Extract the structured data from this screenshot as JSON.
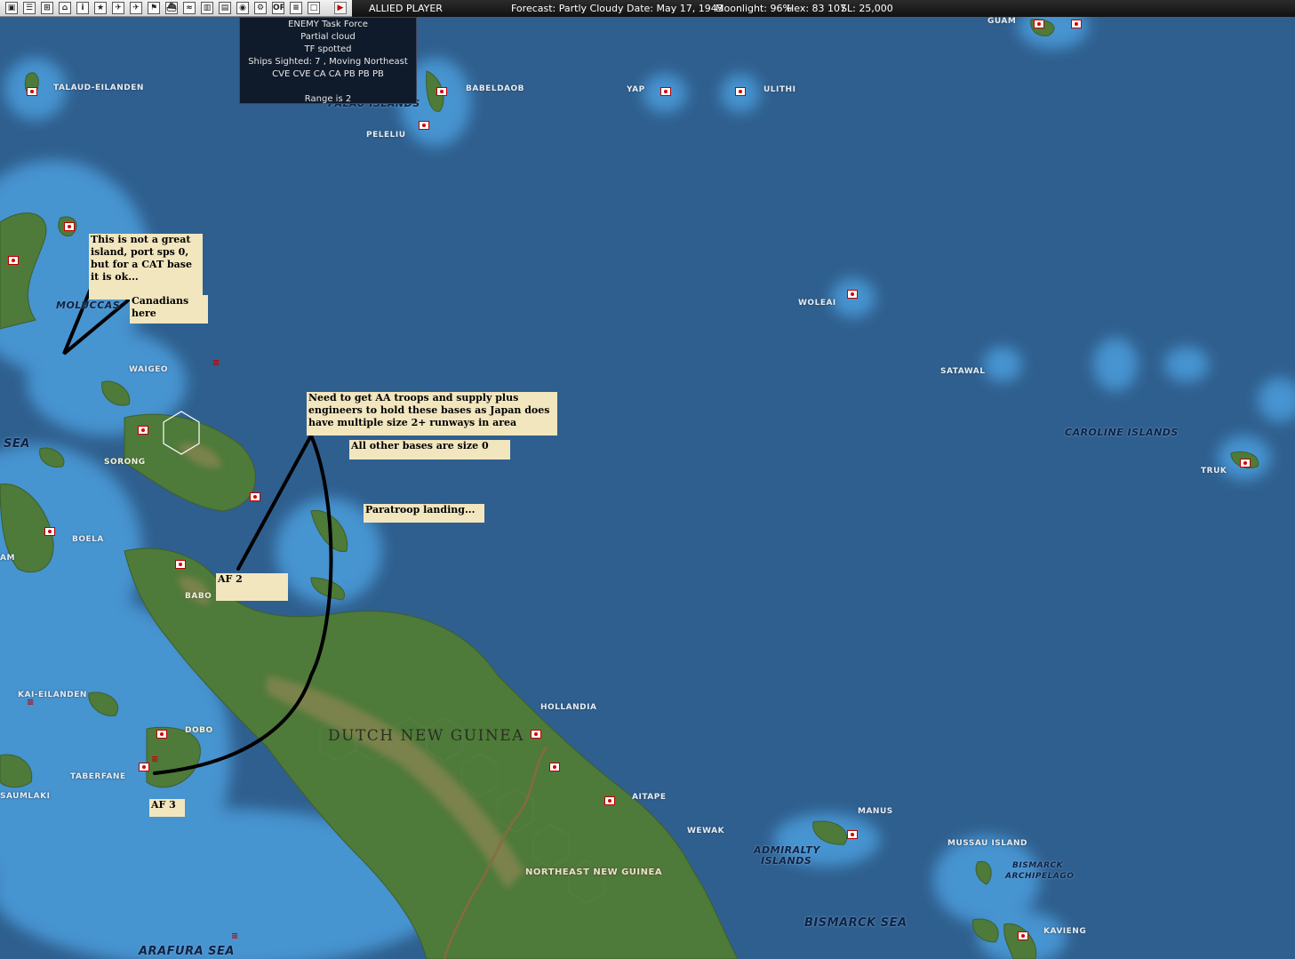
{
  "toolbar": {
    "buttons": [
      {
        "name": "save-button",
        "glyph": "▣"
      },
      {
        "name": "reports-button",
        "glyph": "☰"
      },
      {
        "name": "intel-button",
        "glyph": "⊞"
      },
      {
        "name": "info-button",
        "glyph": "⌂"
      },
      {
        "name": "database-button",
        "glyph": "i"
      },
      {
        "name": "medal-button",
        "glyph": "★"
      },
      {
        "name": "fighter-button",
        "glyph": "✈"
      },
      {
        "name": "bomber-button",
        "glyph": "✈"
      },
      {
        "name": "flag-button",
        "glyph": "⚑"
      },
      {
        "name": "ship-button",
        "glyph": "⛴"
      },
      {
        "name": "lcu-button",
        "glyph": "≈"
      },
      {
        "name": "chart-button",
        "glyph": "▥"
      },
      {
        "name": "map-button",
        "glyph": "▤"
      },
      {
        "name": "globe-button",
        "glyph": "◉"
      },
      {
        "name": "settings-button",
        "glyph": "⚙"
      },
      {
        "name": "op-button",
        "glyph": "OP"
      },
      {
        "name": "list-button",
        "glyph": "≡"
      },
      {
        "name": "window-button",
        "glyph": "□"
      },
      {
        "name": "end-turn-button",
        "glyph": "▶"
      }
    ],
    "player": "ALLIED PLAYER",
    "forecast": "Forecast: Partly Cloudy",
    "date": "Date: May 17, 1943",
    "moonlight": "Moonlight: 96%",
    "hex": "Hex: 83 107",
    "sl": "SL: 25,000"
  },
  "map_labels": {
    "guam": "GUAM",
    "talaud": "TALAUD-EILANDEN",
    "palau": "PALAU ISLANDS",
    "babeldaob": "BABELDAOB",
    "yap": "YAP",
    "ulithi": "ULITHI",
    "peleliu": "PELELIU",
    "moluccas": "MOLUCCAS",
    "waigeo": "WAIGEO",
    "woleai": "WOLEAI",
    "satawal": "SATAWAL",
    "caroline": "CAROLINE ISLANDS",
    "truk": "TRUK",
    "sea": "SEA",
    "sorong": "SORONG",
    "boela": "BOELA",
    "am": "AM",
    "babo": "BABO",
    "kai": "KAI-EILANDEN",
    "hollandia": "HOLLANDIA",
    "dutch_new_guinea": "DUTCH NEW GUINEA",
    "dobo": "DOBO",
    "taberfane": "TABERFANE",
    "saumlaki": "SAUMLAKI",
    "aitape": "AITAPE",
    "manus": "MANUS",
    "wewak": "WEWAK",
    "admiralty": "ADMIRALTY",
    "admiralty2": "ISLANDS",
    "mussau": "MUSSAU ISLAND",
    "bismarck_arch": "BISMARCK",
    "bismarck_arch2": "ARCHIPELAGO",
    "northeast_ng": "NORTHEAST NEW GUINEA",
    "bismarck_sea": "BISMARCK SEA",
    "kavieng": "KAVIENG",
    "arafura": "ARAFURA SEA"
  },
  "notes": {
    "cat_base": "This is not a great island, port sps 0, but for a CAT base it is ok...",
    "canadians": "Canadians here",
    "aa_troops": "Need to get AA troops and supply plus engineers to hold these bases as Japan does have multiple size 2+ runways in area",
    "other_bases": "All other bases are size 0",
    "paratroop": "Paratroop landing...",
    "af2": "AF 2",
    "af3": "AF 3"
  },
  "tf_popup": {
    "line1": "ENEMY Task Force",
    "line2": "Partial cloud",
    "line3": "TF spotted",
    "line4": "Ships Sighted: 7 , Moving Northeast",
    "line5": "CVE CVE CA CA PB PB PB",
    "line6": "Range is 2"
  },
  "colors": {
    "ocean": "#2f5f8e",
    "shallow": "#4a9ad8",
    "land": "#4e7a3a",
    "mountain": "#a08a5a",
    "note_bg": "#f2e6bf",
    "popup_bg": "#0f1a2a",
    "enemy_base": "#d00000"
  }
}
